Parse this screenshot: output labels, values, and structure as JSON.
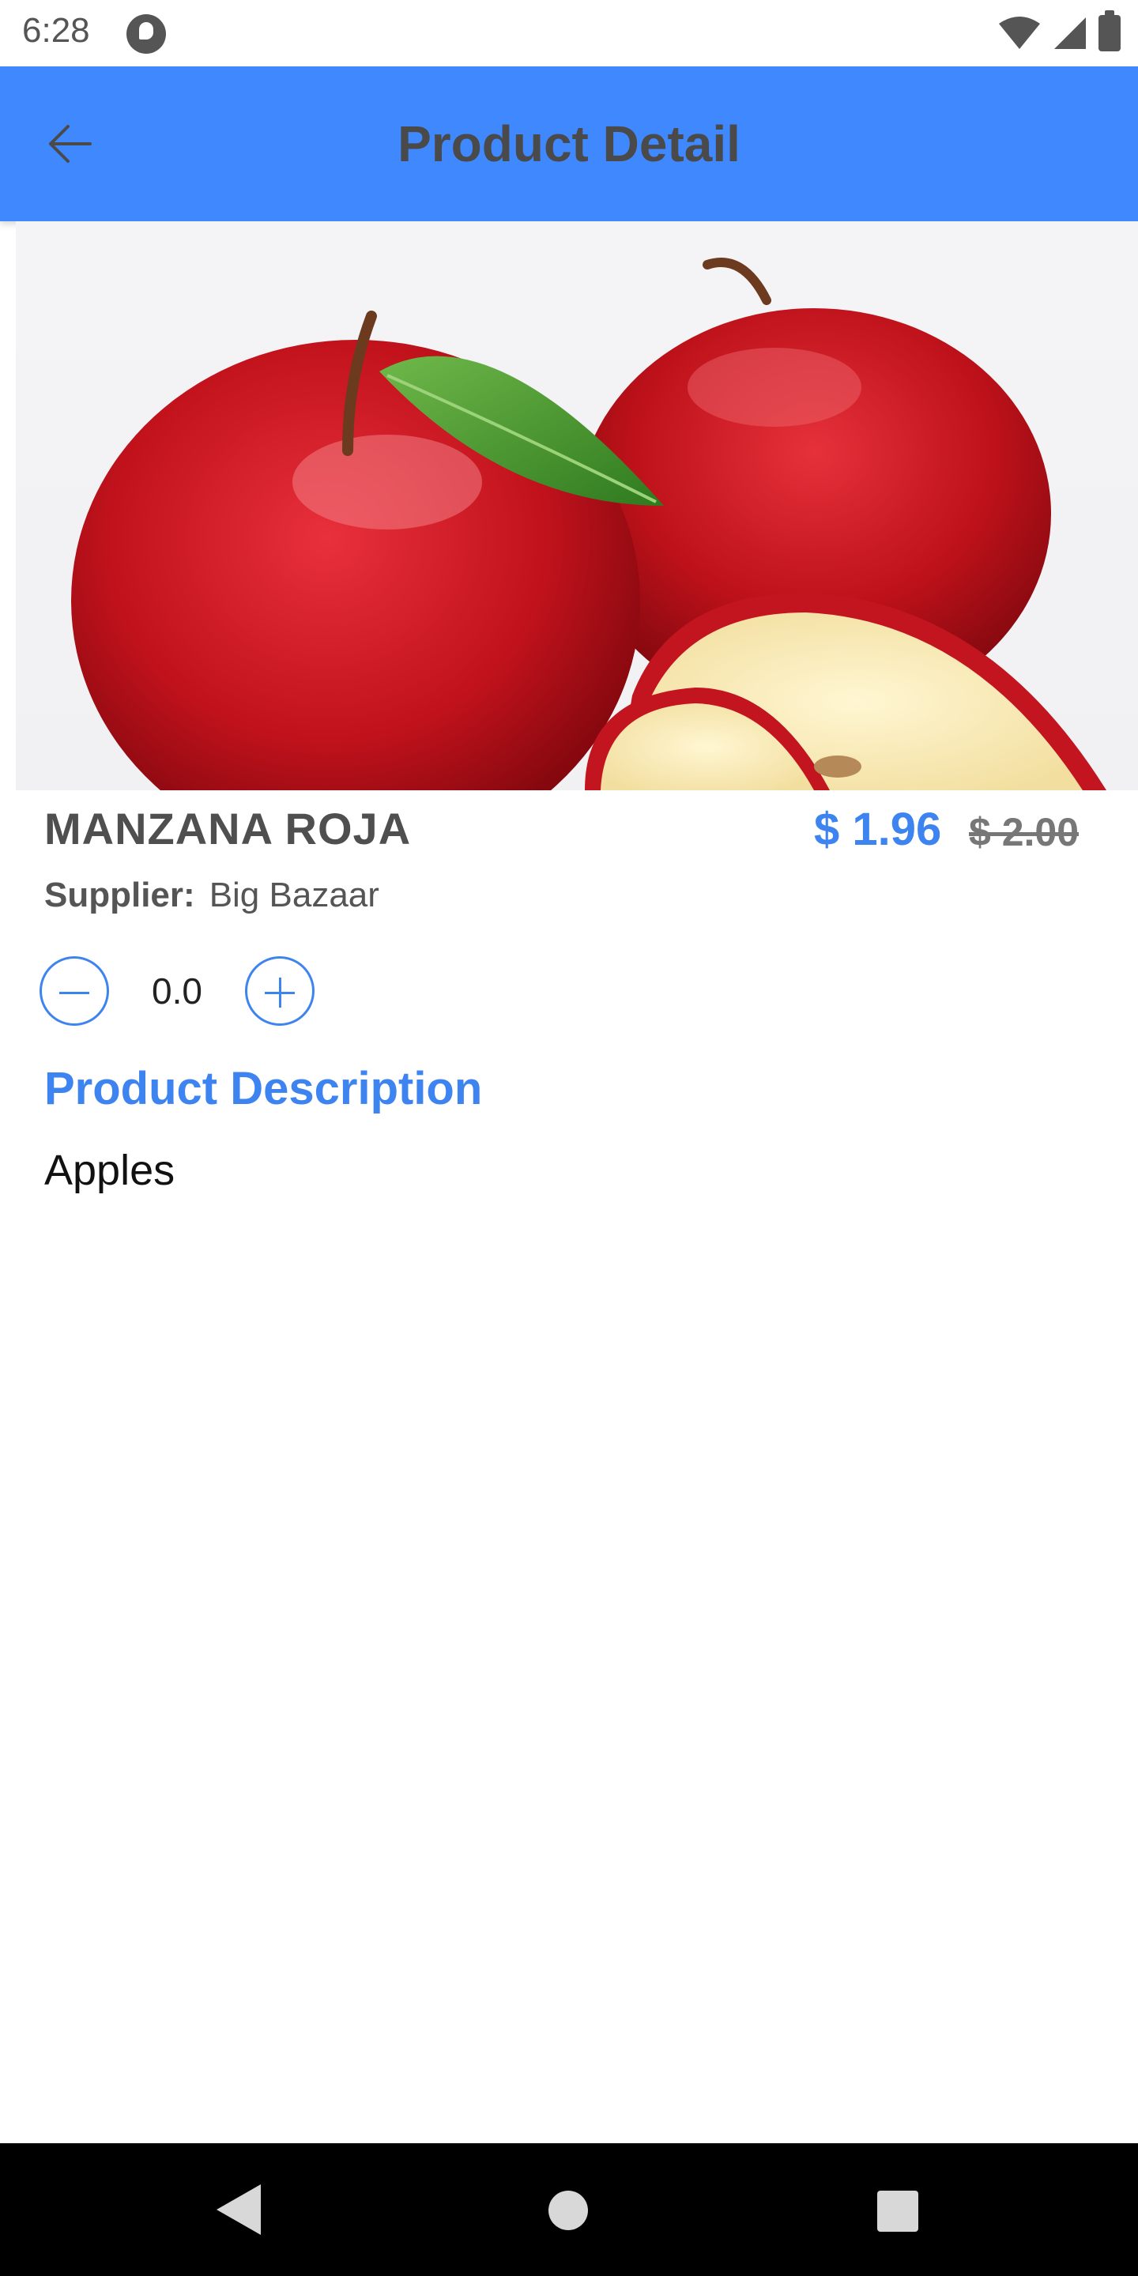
{
  "status_bar": {
    "time": "6:28",
    "icons": [
      "app-notification-icon",
      "wifi-icon",
      "signal-icon",
      "battery-icon"
    ]
  },
  "app_bar": {
    "title": "Product Detail",
    "back_icon": "arrow-left-icon",
    "background_color": "#4088fd"
  },
  "product": {
    "image": "red-apples-image",
    "name": "MANZANA ROJA",
    "price": "$ 1.96",
    "original_price": "$ 2.00",
    "supplier_label": "Supplier:",
    "supplier": "Big Bazaar",
    "quantity": "0.0",
    "description_heading": "Product Description",
    "description": "Apples"
  },
  "colors": {
    "accent": "#3e84f0",
    "title_text": "#4a4a4a"
  },
  "nav_bar": {
    "icons": [
      "back-triangle-icon",
      "home-circle-icon",
      "recents-square-icon"
    ]
  }
}
